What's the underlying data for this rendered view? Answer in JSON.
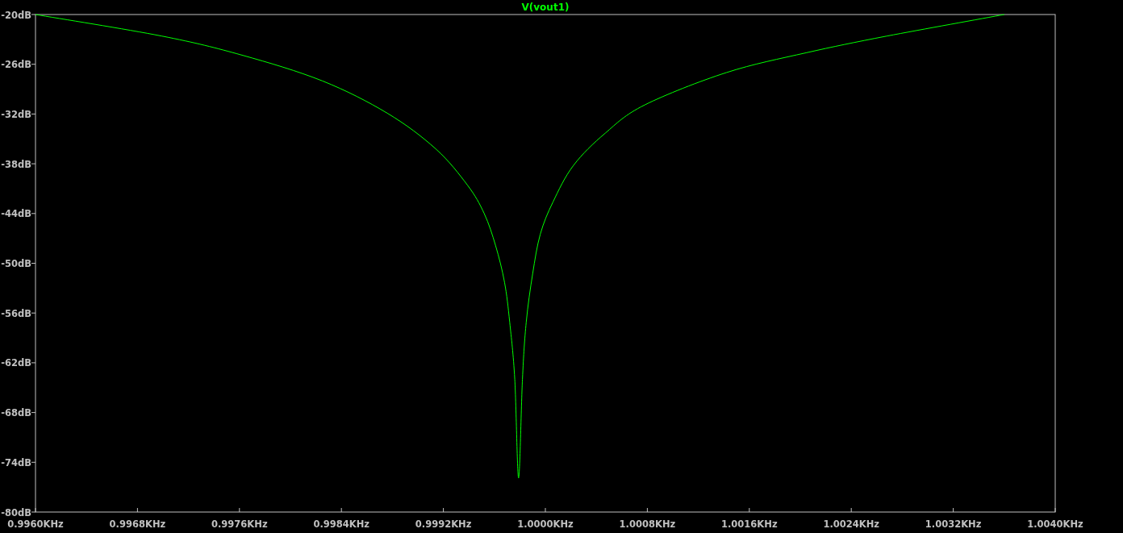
{
  "plot": {
    "chart_data": {
      "type": "line",
      "x": [
        0.996,
        0.99699,
        0.99762,
        0.99825,
        0.99876,
        0.99914,
        0.99939,
        0.99952,
        0.99961,
        0.99968,
        0.99972,
        0.99976,
        0.99979,
        0.99982,
        0.99985,
        0.9999,
        0.99996,
        1.00006,
        1.00022,
        1.00047,
        1.00078,
        1.00142,
        1.00205,
        1.00268,
        1.0036
      ],
      "series": [
        {
          "name": "V(vout1)",
          "color": "#00ff00",
          "values": [
            -20,
            -22.6,
            -24.9,
            -28.0,
            -31.9,
            -36.2,
            -40.6,
            -44.0,
            -47.9,
            -52.3,
            -57.1,
            -64.0,
            -75.9,
            -64.0,
            -57.1,
            -51.3,
            -46.5,
            -42.6,
            -38.2,
            -34.3,
            -30.9,
            -27.0,
            -24.6,
            -22.6,
            -20
          ]
        }
      ],
      "xlim": [
        0.996,
        1.004
      ],
      "ylim": [
        -80,
        -20
      ],
      "xticks": [
        {
          "value": 0.996,
          "label": "0.9960KHz"
        },
        {
          "value": 0.9968,
          "label": "0.9968KHz"
        },
        {
          "value": 0.9976,
          "label": "0.9976KHz"
        },
        {
          "value": 0.9984,
          "label": "0.9984KHz"
        },
        {
          "value": 0.9992,
          "label": "0.9992KHz"
        },
        {
          "value": 1.0,
          "label": "1.0000KHz"
        },
        {
          "value": 1.0008,
          "label": "1.0008KHz"
        },
        {
          "value": 1.0016,
          "label": "1.0016KHz"
        },
        {
          "value": 1.0024,
          "label": "1.0024KHz"
        },
        {
          "value": 1.0032,
          "label": "1.0032KHz"
        },
        {
          "value": 1.004,
          "label": "1.0040KHz"
        }
      ],
      "yticks": [
        {
          "value": -20,
          "label": "-20dB"
        },
        {
          "value": -26,
          "label": "-26dB"
        },
        {
          "value": -32,
          "label": "-32dB"
        },
        {
          "value": -38,
          "label": "-38dB"
        },
        {
          "value": -44,
          "label": "-44dB"
        },
        {
          "value": -50,
          "label": "-50dB"
        },
        {
          "value": -56,
          "label": "-56dB"
        },
        {
          "value": -62,
          "label": "-62dB"
        },
        {
          "value": -68,
          "label": "-68dB"
        },
        {
          "value": -74,
          "label": "-74dB"
        },
        {
          "value": -80,
          "label": "-80dB"
        }
      ]
    }
  }
}
